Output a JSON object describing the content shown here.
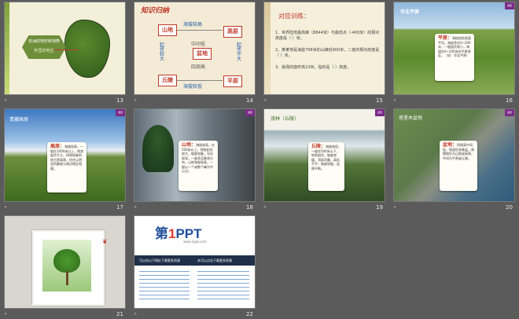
{
  "slides": [
    {
      "number": "13",
      "title": "非洲的地形和地势",
      "subtitle": "阿里的地位"
    },
    {
      "number": "14",
      "heading": "知识归纳",
      "boxes": {
        "mountain": "山地",
        "plateau": "高原",
        "basin": "盆地",
        "hills": "丘陵",
        "plain": "平原"
      },
      "labels": {
        "alt_high": "海拔较高",
        "alt_low": "海拔较低",
        "mid_low": "中间低",
        "around_high": "四周高",
        "undulate_big": "起伏较大",
        "undulate_small": "起伏不大"
      }
    },
    {
      "number": "15",
      "heading": "对应训练：",
      "q1": "1、世界陆地最高峰（8844米）与最低点（-400米）的相对高度是（    ）米。",
      "q2": "2、某某地是海拔768米的山峰低900米，二者的相对高度是（    ）米。",
      "q3": "3、操场的旗杆高10米，指的是（  ）高度。"
    },
    {
      "number": "16",
      "title": "华北平原",
      "term": "平原：",
      "text": "海拔较低地面平坦，海拔多在0~200米，一般起伏较小，海拔在0~200米的平原地区。（如：华北平原）"
    },
    {
      "number": "17",
      "title": "青藏高原",
      "term": "高原：",
      "text": "海拔较高，一般在1000米以上，地势起伏不大，四周较陡的地方是高原，往往以明显的陡坡与周边地区相隔。"
    },
    {
      "number": "18",
      "term": "山地：",
      "text": "海拔较高，在500米以上，地势起伏较大，坡度较陡，沟谷较深，一般多呈脉状分布。山地海拔较高，一般以一个或数个峰为中心点。"
    },
    {
      "number": "19",
      "title": "茂林（丘陵）",
      "term": "丘陵：",
      "text": "海拔较低，一般在500米以下，地势起伏，坡度较缓，顶部浑圆，高低不平，坡度较缓，连绵不断。"
    },
    {
      "number": "20",
      "title": "塔里木盆地",
      "term": "盆地：",
      "text": "四周高中间低，地面形态像盆，周围地形为山地或高原，中间为平原或丘陵。"
    },
    {
      "number": "21"
    },
    {
      "number": "22",
      "logo_a": "第",
      "logo_one": "1",
      "logo_b": "PPT",
      "url": "www.1ppt.com",
      "left_head": "可以在以下网址下载更多资源",
      "right_head": "本可以点击下载更多资源"
    }
  ],
  "corner_tag": "返回",
  "colors": {
    "background": "#5b5b5b",
    "accent_red": "#c0392b",
    "accent_purple": "#7b2a87",
    "ppt_blue": "#1f4e9c"
  }
}
